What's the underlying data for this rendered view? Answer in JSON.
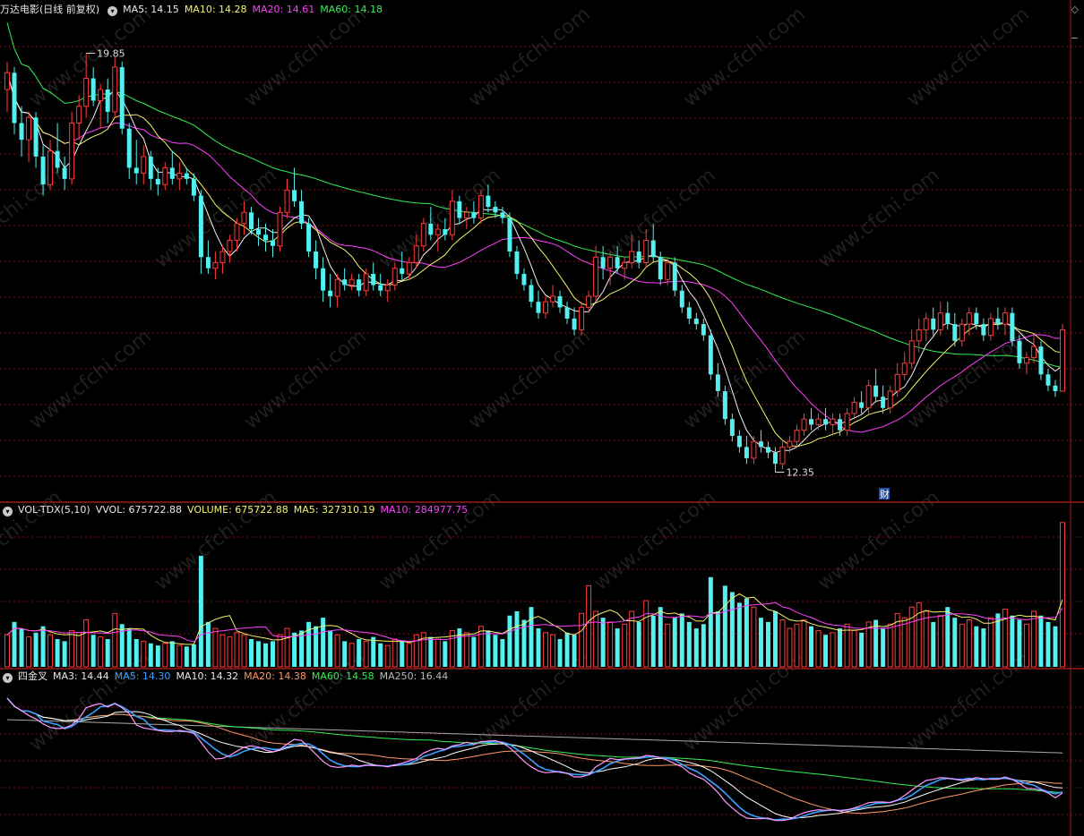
{
  "header": {
    "title": "万达电影(日线 前复权)",
    "ma5": "MA5: 14.15",
    "ma10": "MA10: 14.28",
    "ma20": "MA20: 14.61",
    "ma60": "MA60: 14.18",
    "corner_icon": "diamond-icon"
  },
  "volume_header": {
    "name": "VOL-TDX(5,10)",
    "vvol": "VVOL: 675722.88",
    "volume": "VOLUME: 675722.88",
    "ma5": "MA5: 327310.19",
    "ma10": "MA10: 284977.75"
  },
  "sijincha_header": {
    "name": "四金叉",
    "ma3": "MA3: 14.44",
    "ma5": "MA5: 14.30",
    "ma10": "MA10: 14.32",
    "ma20": "MA20: 14.38",
    "ma60": "MA60: 14.58",
    "ma250": "MA250: 16.44"
  },
  "annotations": {
    "high_label": "19.85",
    "low_label": "12.35",
    "finance_marker": "财"
  },
  "watermark": "www.cfchi.com",
  "colors": {
    "up": "#ff3b3b",
    "down": "#54f0f0",
    "ma5": "#f0f0f0",
    "ma10": "#f5f26b",
    "ma20": "#ff3fff",
    "ma60": "#33ee55",
    "grid": "#7a1010",
    "panel_border": "#9b1b1b"
  },
  "chart_data": {
    "type": "candlestick",
    "price_range": [
      12.35,
      19.85
    ],
    "volume_range": [
      0,
      700000
    ],
    "candles": [
      {
        "o": 19.2,
        "h": 19.7,
        "l": 18.8,
        "c": 19.5,
        "v": 150000
      },
      {
        "o": 19.5,
        "h": 19.6,
        "l": 18.4,
        "c": 18.6,
        "v": 210000
      },
      {
        "o": 18.6,
        "h": 18.9,
        "l": 18.0,
        "c": 18.3,
        "v": 180000
      },
      {
        "o": 18.3,
        "h": 18.8,
        "l": 17.9,
        "c": 18.7,
        "v": 140000
      },
      {
        "o": 18.7,
        "h": 18.8,
        "l": 17.8,
        "c": 18.0,
        "v": 160000
      },
      {
        "o": 18.0,
        "h": 18.2,
        "l": 17.3,
        "c": 17.5,
        "v": 190000
      },
      {
        "o": 17.5,
        "h": 18.3,
        "l": 17.4,
        "c": 18.1,
        "v": 150000
      },
      {
        "o": 18.1,
        "h": 18.6,
        "l": 17.7,
        "c": 17.8,
        "v": 130000
      },
      {
        "o": 17.8,
        "h": 18.0,
        "l": 17.4,
        "c": 17.6,
        "v": 120000
      },
      {
        "o": 17.6,
        "h": 18.8,
        "l": 17.5,
        "c": 18.6,
        "v": 170000
      },
      {
        "o": 18.6,
        "h": 19.1,
        "l": 18.3,
        "c": 18.9,
        "v": 160000
      },
      {
        "o": 18.9,
        "h": 19.85,
        "l": 18.7,
        "c": 19.4,
        "v": 220000
      },
      {
        "o": 19.4,
        "h": 19.6,
        "l": 18.9,
        "c": 19.0,
        "v": 150000
      },
      {
        "o": 19.0,
        "h": 19.3,
        "l": 18.5,
        "c": 19.2,
        "v": 140000
      },
      {
        "o": 19.2,
        "h": 19.4,
        "l": 18.6,
        "c": 18.8,
        "v": 130000
      },
      {
        "o": 18.8,
        "h": 19.8,
        "l": 18.7,
        "c": 19.6,
        "v": 250000
      },
      {
        "o": 19.6,
        "h": 19.7,
        "l": 18.4,
        "c": 18.5,
        "v": 200000
      },
      {
        "o": 18.5,
        "h": 18.6,
        "l": 17.6,
        "c": 17.8,
        "v": 180000
      },
      {
        "o": 17.8,
        "h": 18.3,
        "l": 17.5,
        "c": 17.7,
        "v": 130000
      },
      {
        "o": 17.7,
        "h": 18.2,
        "l": 17.5,
        "c": 18.0,
        "v": 120000
      },
      {
        "o": 18.0,
        "h": 18.1,
        "l": 17.4,
        "c": 17.6,
        "v": 110000
      },
      {
        "o": 17.6,
        "h": 17.8,
        "l": 17.3,
        "c": 17.5,
        "v": 100000
      },
      {
        "o": 17.5,
        "h": 17.9,
        "l": 17.4,
        "c": 17.8,
        "v": 110000
      },
      {
        "o": 17.8,
        "h": 18.1,
        "l": 17.5,
        "c": 17.6,
        "v": 120000
      },
      {
        "o": 17.6,
        "h": 17.9,
        "l": 17.4,
        "c": 17.7,
        "v": 100000
      },
      {
        "o": 17.7,
        "h": 17.8,
        "l": 17.5,
        "c": 17.6,
        "v": 95000
      },
      {
        "o": 17.6,
        "h": 17.7,
        "l": 17.2,
        "c": 17.3,
        "v": 105000
      },
      {
        "o": 17.3,
        "h": 17.4,
        "l": 15.9,
        "c": 16.2,
        "v": 520000
      },
      {
        "o": 16.2,
        "h": 16.5,
        "l": 15.9,
        "c": 16.0,
        "v": 210000
      },
      {
        "o": 16.0,
        "h": 16.3,
        "l": 15.8,
        "c": 16.1,
        "v": 180000
      },
      {
        "o": 16.1,
        "h": 16.4,
        "l": 15.9,
        "c": 16.3,
        "v": 150000
      },
      {
        "o": 16.3,
        "h": 16.6,
        "l": 16.1,
        "c": 16.5,
        "v": 140000
      },
      {
        "o": 16.5,
        "h": 16.9,
        "l": 16.3,
        "c": 16.8,
        "v": 160000
      },
      {
        "o": 16.8,
        "h": 17.2,
        "l": 16.6,
        "c": 17.0,
        "v": 150000
      },
      {
        "o": 17.0,
        "h": 17.1,
        "l": 16.6,
        "c": 16.7,
        "v": 130000
      },
      {
        "o": 16.7,
        "h": 16.9,
        "l": 16.4,
        "c": 16.6,
        "v": 120000
      },
      {
        "o": 16.6,
        "h": 16.8,
        "l": 16.3,
        "c": 16.5,
        "v": 110000
      },
      {
        "o": 16.5,
        "h": 16.7,
        "l": 16.2,
        "c": 16.4,
        "v": 120000
      },
      {
        "o": 16.4,
        "h": 17.1,
        "l": 16.3,
        "c": 17.0,
        "v": 150000
      },
      {
        "o": 17.0,
        "h": 17.6,
        "l": 16.9,
        "c": 17.4,
        "v": 180000
      },
      {
        "o": 17.4,
        "h": 17.8,
        "l": 17.1,
        "c": 17.2,
        "v": 160000
      },
      {
        "o": 17.2,
        "h": 17.4,
        "l": 16.7,
        "c": 16.8,
        "v": 170000
      },
      {
        "o": 16.8,
        "h": 16.9,
        "l": 16.2,
        "c": 16.3,
        "v": 210000
      },
      {
        "o": 16.3,
        "h": 16.5,
        "l": 15.8,
        "c": 16.0,
        "v": 190000
      },
      {
        "o": 16.0,
        "h": 16.2,
        "l": 15.4,
        "c": 15.6,
        "v": 230000
      },
      {
        "o": 15.6,
        "h": 15.9,
        "l": 15.3,
        "c": 15.5,
        "v": 170000
      },
      {
        "o": 15.5,
        "h": 15.9,
        "l": 15.3,
        "c": 15.8,
        "v": 150000
      },
      {
        "o": 15.8,
        "h": 16.0,
        "l": 15.6,
        "c": 15.7,
        "v": 120000
      },
      {
        "o": 15.7,
        "h": 15.9,
        "l": 15.6,
        "c": 15.8,
        "v": 110000
      },
      {
        "o": 15.8,
        "h": 15.9,
        "l": 15.5,
        "c": 15.6,
        "v": 130000
      },
      {
        "o": 15.6,
        "h": 16.0,
        "l": 15.5,
        "c": 15.9,
        "v": 120000
      },
      {
        "o": 15.9,
        "h": 16.1,
        "l": 15.6,
        "c": 15.7,
        "v": 140000
      },
      {
        "o": 15.7,
        "h": 15.9,
        "l": 15.5,
        "c": 15.6,
        "v": 110000
      },
      {
        "o": 15.6,
        "h": 15.8,
        "l": 15.4,
        "c": 15.7,
        "v": 100000
      },
      {
        "o": 15.7,
        "h": 16.1,
        "l": 15.6,
        "c": 16.0,
        "v": 130000
      },
      {
        "o": 16.0,
        "h": 16.3,
        "l": 15.8,
        "c": 15.9,
        "v": 120000
      },
      {
        "o": 15.9,
        "h": 16.2,
        "l": 15.8,
        "c": 16.1,
        "v": 110000
      },
      {
        "o": 16.1,
        "h": 16.6,
        "l": 16.0,
        "c": 16.4,
        "v": 150000
      },
      {
        "o": 16.4,
        "h": 16.9,
        "l": 16.3,
        "c": 16.8,
        "v": 160000
      },
      {
        "o": 16.8,
        "h": 17.1,
        "l": 16.5,
        "c": 16.6,
        "v": 140000
      },
      {
        "o": 16.6,
        "h": 16.8,
        "l": 16.3,
        "c": 16.7,
        "v": 130000
      },
      {
        "o": 16.7,
        "h": 16.9,
        "l": 16.5,
        "c": 16.6,
        "v": 120000
      },
      {
        "o": 16.6,
        "h": 17.4,
        "l": 16.5,
        "c": 17.2,
        "v": 170000
      },
      {
        "o": 17.2,
        "h": 17.3,
        "l": 16.8,
        "c": 16.9,
        "v": 180000
      },
      {
        "o": 16.9,
        "h": 17.1,
        "l": 16.7,
        "c": 17.0,
        "v": 160000
      },
      {
        "o": 17.0,
        "h": 17.2,
        "l": 16.8,
        "c": 16.9,
        "v": 140000
      },
      {
        "o": 16.9,
        "h": 17.4,
        "l": 16.8,
        "c": 17.3,
        "v": 190000
      },
      {
        "o": 17.3,
        "h": 17.5,
        "l": 17.0,
        "c": 17.1,
        "v": 170000
      },
      {
        "o": 17.1,
        "h": 17.2,
        "l": 16.9,
        "c": 17.0,
        "v": 150000
      },
      {
        "o": 17.0,
        "h": 17.1,
        "l": 16.8,
        "c": 16.9,
        "v": 130000
      },
      {
        "o": 16.9,
        "h": 17.0,
        "l": 16.2,
        "c": 16.3,
        "v": 240000
      },
      {
        "o": 16.3,
        "h": 16.4,
        "l": 15.8,
        "c": 15.9,
        "v": 260000
      },
      {
        "o": 15.9,
        "h": 16.0,
        "l": 15.6,
        "c": 15.7,
        "v": 220000
      },
      {
        "o": 15.7,
        "h": 15.8,
        "l": 15.3,
        "c": 15.4,
        "v": 280000
      },
      {
        "o": 15.4,
        "h": 15.6,
        "l": 15.1,
        "c": 15.2,
        "v": 180000
      },
      {
        "o": 15.2,
        "h": 15.5,
        "l": 15.1,
        "c": 15.4,
        "v": 160000
      },
      {
        "o": 15.4,
        "h": 15.7,
        "l": 15.3,
        "c": 15.5,
        "v": 150000
      },
      {
        "o": 15.5,
        "h": 15.6,
        "l": 15.2,
        "c": 15.3,
        "v": 130000
      },
      {
        "o": 15.3,
        "h": 15.4,
        "l": 15.0,
        "c": 15.1,
        "v": 160000
      },
      {
        "o": 15.1,
        "h": 15.3,
        "l": 14.8,
        "c": 14.9,
        "v": 150000
      },
      {
        "o": 14.9,
        "h": 15.4,
        "l": 14.8,
        "c": 15.3,
        "v": 250000
      },
      {
        "o": 15.3,
        "h": 15.6,
        "l": 15.2,
        "c": 15.5,
        "v": 380000
      },
      {
        "o": 15.5,
        "h": 16.4,
        "l": 15.4,
        "c": 16.2,
        "v": 260000
      },
      {
        "o": 16.2,
        "h": 16.4,
        "l": 15.8,
        "c": 16.0,
        "v": 230000
      },
      {
        "o": 16.0,
        "h": 16.3,
        "l": 15.7,
        "c": 16.2,
        "v": 210000
      },
      {
        "o": 16.2,
        "h": 16.4,
        "l": 15.9,
        "c": 16.0,
        "v": 180000
      },
      {
        "o": 16.0,
        "h": 16.2,
        "l": 15.8,
        "c": 16.1,
        "v": 200000
      },
      {
        "o": 16.1,
        "h": 16.6,
        "l": 16.0,
        "c": 16.3,
        "v": 260000
      },
      {
        "o": 16.3,
        "h": 16.5,
        "l": 16.0,
        "c": 16.1,
        "v": 210000
      },
      {
        "o": 16.1,
        "h": 16.7,
        "l": 16.0,
        "c": 16.5,
        "v": 310000
      },
      {
        "o": 16.5,
        "h": 16.8,
        "l": 16.1,
        "c": 16.2,
        "v": 240000
      },
      {
        "o": 16.2,
        "h": 16.3,
        "l": 15.7,
        "c": 15.8,
        "v": 280000
      },
      {
        "o": 15.8,
        "h": 16.2,
        "l": 15.7,
        "c": 16.1,
        "v": 200000
      },
      {
        "o": 16.1,
        "h": 16.2,
        "l": 15.5,
        "c": 15.6,
        "v": 230000
      },
      {
        "o": 15.6,
        "h": 15.7,
        "l": 15.2,
        "c": 15.3,
        "v": 250000
      },
      {
        "o": 15.3,
        "h": 15.4,
        "l": 15.0,
        "c": 15.1,
        "v": 210000
      },
      {
        "o": 15.1,
        "h": 15.2,
        "l": 14.9,
        "c": 15.0,
        "v": 180000
      },
      {
        "o": 15.0,
        "h": 15.1,
        "l": 14.7,
        "c": 14.8,
        "v": 200000
      },
      {
        "o": 14.8,
        "h": 14.9,
        "l": 14.0,
        "c": 14.1,
        "v": 420000
      },
      {
        "o": 14.1,
        "h": 14.3,
        "l": 13.7,
        "c": 13.8,
        "v": 260000
      },
      {
        "o": 13.8,
        "h": 13.9,
        "l": 13.2,
        "c": 13.3,
        "v": 380000
      },
      {
        "o": 13.3,
        "h": 13.4,
        "l": 12.9,
        "c": 13.0,
        "v": 350000
      },
      {
        "o": 13.0,
        "h": 13.1,
        "l": 12.7,
        "c": 12.8,
        "v": 300000
      },
      {
        "o": 12.8,
        "h": 13.0,
        "l": 12.5,
        "c": 12.6,
        "v": 320000
      },
      {
        "o": 12.6,
        "h": 13.0,
        "l": 12.5,
        "c": 12.9,
        "v": 280000
      },
      {
        "o": 12.9,
        "h": 13.1,
        "l": 12.7,
        "c": 12.8,
        "v": 230000
      },
      {
        "o": 12.8,
        "h": 12.9,
        "l": 12.6,
        "c": 12.7,
        "v": 210000
      },
      {
        "o": 12.7,
        "h": 12.8,
        "l": 12.35,
        "c": 12.5,
        "v": 260000
      },
      {
        "o": 12.5,
        "h": 12.9,
        "l": 12.4,
        "c": 12.8,
        "v": 220000
      },
      {
        "o": 12.8,
        "h": 13.0,
        "l": 12.7,
        "c": 12.9,
        "v": 180000
      },
      {
        "o": 12.9,
        "h": 13.2,
        "l": 12.8,
        "c": 13.1,
        "v": 200000
      },
      {
        "o": 13.1,
        "h": 13.4,
        "l": 13.0,
        "c": 13.3,
        "v": 220000
      },
      {
        "o": 13.3,
        "h": 13.5,
        "l": 13.1,
        "c": 13.2,
        "v": 190000
      },
      {
        "o": 13.2,
        "h": 13.4,
        "l": 13.1,
        "c": 13.3,
        "v": 170000
      },
      {
        "o": 13.3,
        "h": 13.5,
        "l": 13.1,
        "c": 13.2,
        "v": 150000
      },
      {
        "o": 13.2,
        "h": 13.4,
        "l": 13.0,
        "c": 13.3,
        "v": 160000
      },
      {
        "o": 13.3,
        "h": 13.4,
        "l": 13.0,
        "c": 13.1,
        "v": 180000
      },
      {
        "o": 13.1,
        "h": 13.5,
        "l": 13.0,
        "c": 13.4,
        "v": 200000
      },
      {
        "o": 13.4,
        "h": 13.7,
        "l": 13.3,
        "c": 13.6,
        "v": 170000
      },
      {
        "o": 13.6,
        "h": 13.8,
        "l": 13.4,
        "c": 13.5,
        "v": 160000
      },
      {
        "o": 13.5,
        "h": 14.0,
        "l": 13.4,
        "c": 13.9,
        "v": 210000
      },
      {
        "o": 13.9,
        "h": 14.2,
        "l": 13.6,
        "c": 13.7,
        "v": 220000
      },
      {
        "o": 13.7,
        "h": 13.9,
        "l": 13.4,
        "c": 13.5,
        "v": 180000
      },
      {
        "o": 13.5,
        "h": 13.9,
        "l": 13.4,
        "c": 13.8,
        "v": 200000
      },
      {
        "o": 13.8,
        "h": 14.3,
        "l": 13.7,
        "c": 14.1,
        "v": 250000
      },
      {
        "o": 14.1,
        "h": 14.5,
        "l": 14.0,
        "c": 14.3,
        "v": 230000
      },
      {
        "o": 14.3,
        "h": 14.9,
        "l": 14.2,
        "c": 14.7,
        "v": 280000
      },
      {
        "o": 14.7,
        "h": 15.1,
        "l": 14.5,
        "c": 14.9,
        "v": 300000
      },
      {
        "o": 14.9,
        "h": 15.2,
        "l": 14.7,
        "c": 15.1,
        "v": 260000
      },
      {
        "o": 15.1,
        "h": 15.3,
        "l": 14.8,
        "c": 14.9,
        "v": 210000
      },
      {
        "o": 14.9,
        "h": 15.4,
        "l": 14.8,
        "c": 15.2,
        "v": 240000
      },
      {
        "o": 15.2,
        "h": 15.4,
        "l": 14.9,
        "c": 15.0,
        "v": 280000
      },
      {
        "o": 15.0,
        "h": 15.2,
        "l": 14.6,
        "c": 14.7,
        "v": 230000
      },
      {
        "o": 14.7,
        "h": 15.1,
        "l": 14.6,
        "c": 15.0,
        "v": 200000
      },
      {
        "o": 15.0,
        "h": 15.3,
        "l": 14.8,
        "c": 15.2,
        "v": 220000
      },
      {
        "o": 15.2,
        "h": 15.3,
        "l": 14.9,
        "c": 15.0,
        "v": 190000
      },
      {
        "o": 15.0,
        "h": 15.1,
        "l": 14.7,
        "c": 14.8,
        "v": 180000
      },
      {
        "o": 14.8,
        "h": 15.2,
        "l": 14.7,
        "c": 15.1,
        "v": 230000
      },
      {
        "o": 15.1,
        "h": 15.3,
        "l": 14.9,
        "c": 15.0,
        "v": 250000
      },
      {
        "o": 15.0,
        "h": 15.3,
        "l": 14.8,
        "c": 15.2,
        "v": 270000
      },
      {
        "o": 15.2,
        "h": 15.3,
        "l": 14.6,
        "c": 14.7,
        "v": 240000
      },
      {
        "o": 14.7,
        "h": 14.8,
        "l": 14.2,
        "c": 14.3,
        "v": 220000
      },
      {
        "o": 14.3,
        "h": 14.5,
        "l": 14.1,
        "c": 14.4,
        "v": 200000
      },
      {
        "o": 14.4,
        "h": 14.8,
        "l": 14.3,
        "c": 14.6,
        "v": 260000
      },
      {
        "o": 14.6,
        "h": 14.7,
        "l": 14.0,
        "c": 14.1,
        "v": 240000
      },
      {
        "o": 14.1,
        "h": 14.2,
        "l": 13.8,
        "c": 13.9,
        "v": 210000
      },
      {
        "o": 13.9,
        "h": 14.0,
        "l": 13.7,
        "c": 13.8,
        "v": 190000
      },
      {
        "o": 13.8,
        "h": 15.0,
        "l": 13.8,
        "c": 14.9,
        "v": 675722.88
      }
    ]
  }
}
